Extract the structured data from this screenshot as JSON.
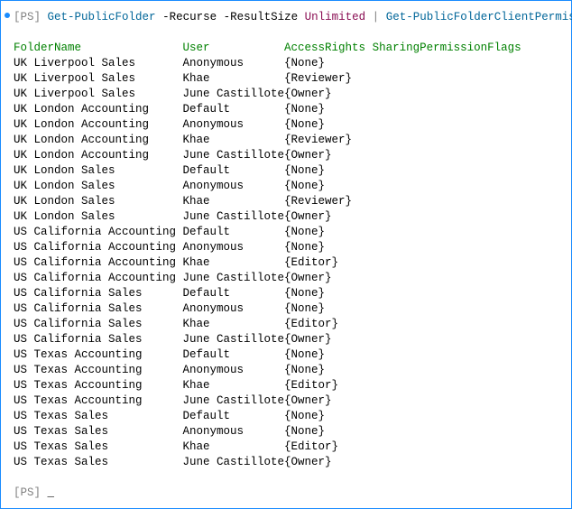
{
  "prompt": "[PS]",
  "cmd1": "Get-PublicFolder",
  "arg1": "-Recurse -ResultSize",
  "argval": "Unlimited",
  "pipe": "|",
  "cmd2": "Get-PublicFolderClientPermission",
  "columns": [
    "FolderName",
    "User",
    "AccessRights",
    "SharingPermissionFlags"
  ],
  "rows": [
    {
      "folder": "UK Liverpool Sales",
      "user": "Anonymous",
      "rights": "{None}"
    },
    {
      "folder": "UK Liverpool Sales",
      "user": "Khae",
      "rights": "{Reviewer}"
    },
    {
      "folder": "UK Liverpool Sales",
      "user": "June Castillote",
      "rights": "{Owner}"
    },
    {
      "folder": "UK London Accounting",
      "user": "Default",
      "rights": "{None}"
    },
    {
      "folder": "UK London Accounting",
      "user": "Anonymous",
      "rights": "{None}"
    },
    {
      "folder": "UK London Accounting",
      "user": "Khae",
      "rights": "{Reviewer}"
    },
    {
      "folder": "UK London Accounting",
      "user": "June Castillote",
      "rights": "{Owner}"
    },
    {
      "folder": "UK London Sales",
      "user": "Default",
      "rights": "{None}"
    },
    {
      "folder": "UK London Sales",
      "user": "Anonymous",
      "rights": "{None}"
    },
    {
      "folder": "UK London Sales",
      "user": "Khae",
      "rights": "{Reviewer}"
    },
    {
      "folder": "UK London Sales",
      "user": "June Castillote",
      "rights": "{Owner}"
    },
    {
      "folder": "US California Accounting",
      "user": "Default",
      "rights": "{None}"
    },
    {
      "folder": "US California Accounting",
      "user": "Anonymous",
      "rights": "{None}"
    },
    {
      "folder": "US California Accounting",
      "user": "Khae",
      "rights": "{Editor}"
    },
    {
      "folder": "US California Accounting",
      "user": "June Castillote",
      "rights": "{Owner}"
    },
    {
      "folder": "US California Sales",
      "user": "Default",
      "rights": "{None}"
    },
    {
      "folder": "US California Sales",
      "user": "Anonymous",
      "rights": "{None}"
    },
    {
      "folder": "US California Sales",
      "user": "Khae",
      "rights": "{Editor}"
    },
    {
      "folder": "US California Sales",
      "user": "June Castillote",
      "rights": "{Owner}"
    },
    {
      "folder": "US Texas Accounting",
      "user": "Default",
      "rights": "{None}"
    },
    {
      "folder": "US Texas Accounting",
      "user": "Anonymous",
      "rights": "{None}"
    },
    {
      "folder": "US Texas Accounting",
      "user": "Khae",
      "rights": "{Editor}"
    },
    {
      "folder": "US Texas Accounting",
      "user": "June Castillote",
      "rights": "{Owner}"
    },
    {
      "folder": "US Texas Sales",
      "user": "Default",
      "rights": "{None}"
    },
    {
      "folder": "US Texas Sales",
      "user": "Anonymous",
      "rights": "{None}"
    },
    {
      "folder": "US Texas Sales",
      "user": "Khae",
      "rights": "{Editor}"
    },
    {
      "folder": "US Texas Sales",
      "user": "June Castillote",
      "rights": "{Owner}"
    }
  ],
  "cursor": "_"
}
